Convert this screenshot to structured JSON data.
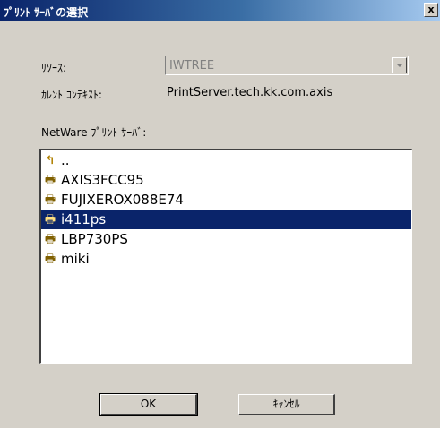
{
  "window": {
    "title": "ﾌﾟﾘﾝﾄ ｻｰﾊﾞの選択",
    "close_glyph": "x"
  },
  "resource": {
    "label": "ﾘｿｰｽ:",
    "value": "IWTREE"
  },
  "context": {
    "label": "ｶﾚﾝﾄ ｺﾝﾃｷｽﾄ:",
    "value": "PrintServer.tech.kk.com.axis"
  },
  "server_list": {
    "label": "NetWare ﾌﾟﾘﾝﾄ ｻｰﾊﾞ:",
    "items": [
      {
        "label": "..",
        "icon": "up-folder-icon",
        "selected": false
      },
      {
        "label": "AXIS3FCC95",
        "icon": "printer-icon",
        "selected": false
      },
      {
        "label": "FUJIXEROX088E74",
        "icon": "printer-icon",
        "selected": false
      },
      {
        "label": "i411ps",
        "icon": "printer-icon",
        "selected": true
      },
      {
        "label": "LBP730PS",
        "icon": "printer-icon",
        "selected": false
      },
      {
        "label": "miki",
        "icon": "printer-icon",
        "selected": false
      }
    ]
  },
  "buttons": {
    "ok": "OK",
    "cancel": "ｷｬﾝｾﾙ"
  },
  "colors": {
    "titlebar_start": "#0a246a",
    "titlebar_end": "#a6caf0",
    "selection": "#0a246a",
    "dialog_face": "#d4d0c8"
  }
}
